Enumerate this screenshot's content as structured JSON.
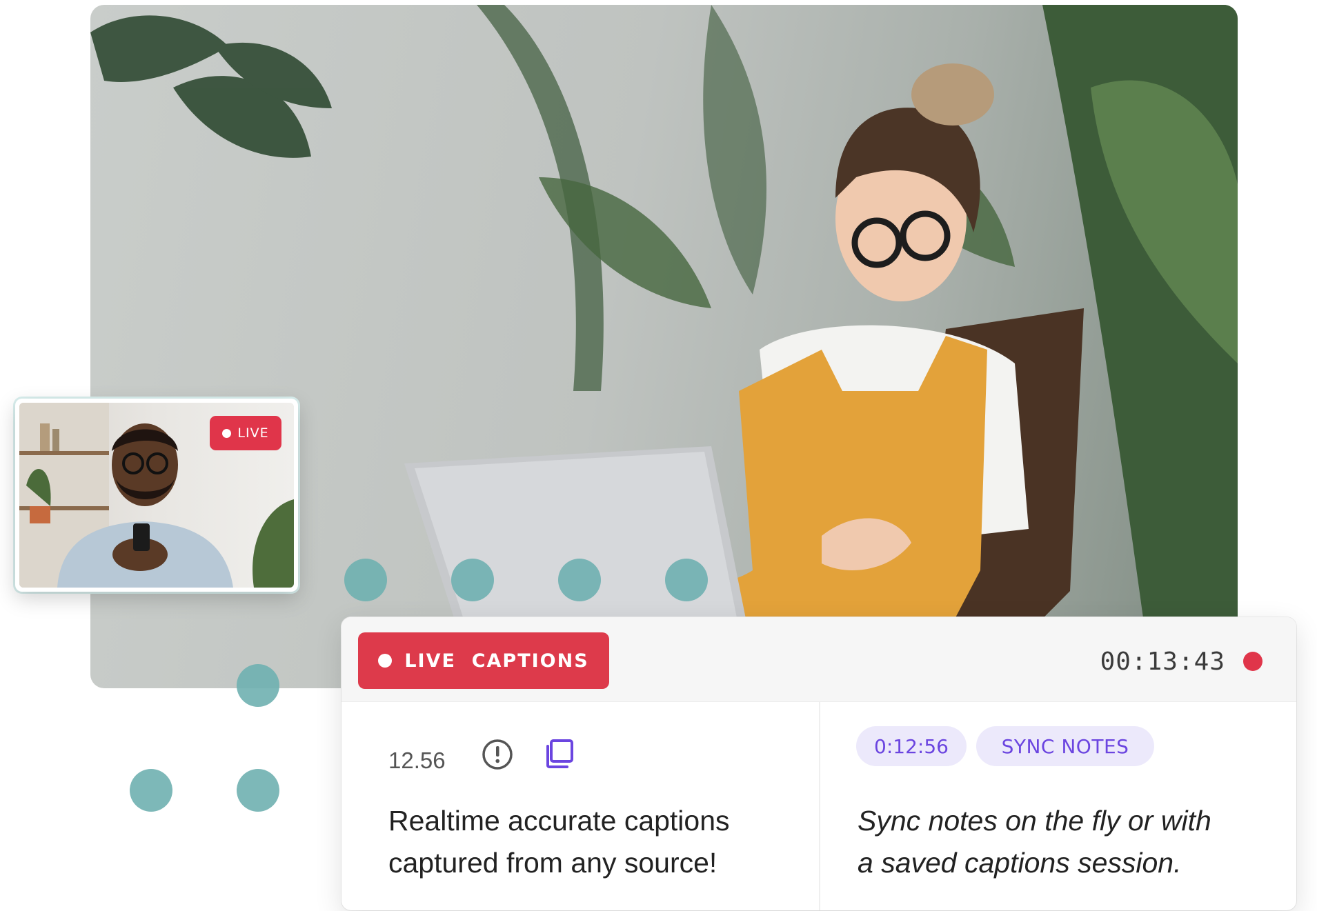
{
  "pip": {
    "live_label": "LIVE"
  },
  "captions": {
    "badge_label": "LIVE  CAPTIONS",
    "timer": "00:13:43"
  },
  "caption_entry": {
    "timestamp": "12.56",
    "text_line1": "Realtime accurate captions",
    "text_line2": "captured from any source!"
  },
  "notes_entry": {
    "timestamp": "0:12:56",
    "action_label": "SYNC NOTES",
    "text_line1": "Sync notes on the fly or with",
    "text_line2": "a saved captions session."
  },
  "colors": {
    "live_red": "#e0354a",
    "accent_purple": "#6b45e0",
    "pill_bg": "#ece9fb",
    "dot_teal": "#6fb0b0"
  },
  "icons": [
    "alert-icon",
    "copy-icon",
    "recording-dot-icon"
  ]
}
